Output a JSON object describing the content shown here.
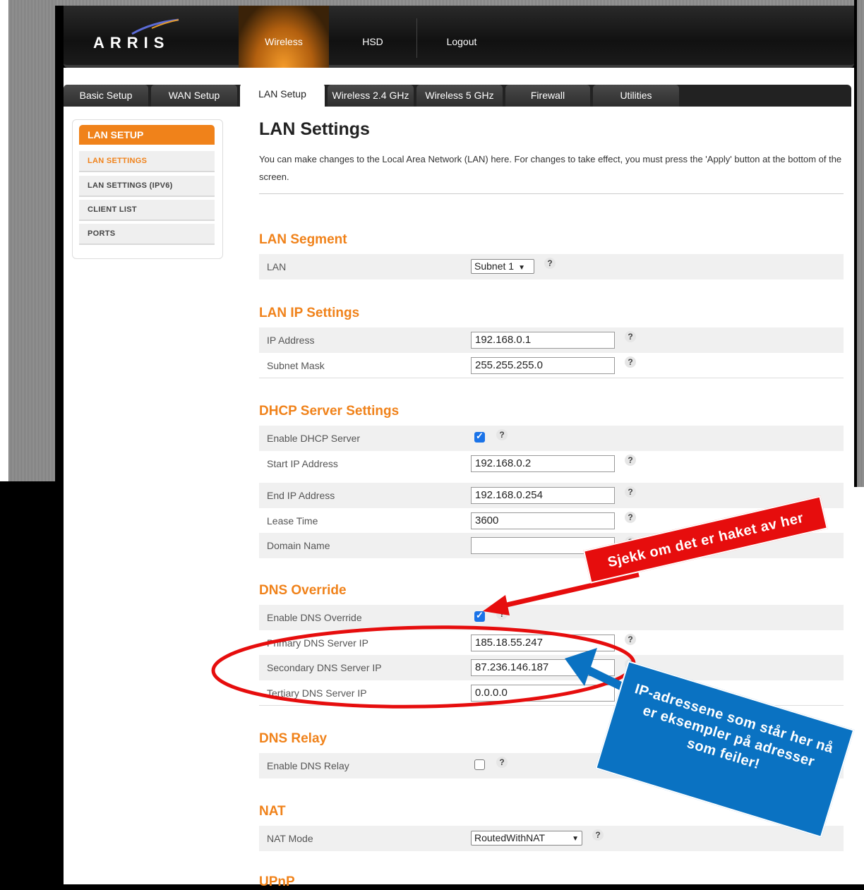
{
  "header": {
    "logo": "ARRIS",
    "nav": [
      "Wireless",
      "HSD",
      "Logout"
    ]
  },
  "tabs": [
    "Basic Setup",
    "WAN Setup",
    "LAN Setup",
    "Wireless 2.4 GHz",
    "Wireless 5 GHz",
    "Firewall",
    "Utilities"
  ],
  "sidebar": {
    "title": "LAN SETUP",
    "items": [
      "LAN SETTINGS",
      "LAN SETTINGS (IPV6)",
      "CLIENT LIST",
      "PORTS"
    ]
  },
  "main": {
    "title": "LAN Settings",
    "intro": "You can make changes to the Local Area Network (LAN) here. For changes to take effect, you must press the 'Apply' button at the bottom of the screen."
  },
  "help_glyph": "?",
  "lan_segment": {
    "heading": "LAN Segment",
    "lan_label": "LAN",
    "lan_value": "Subnet 1"
  },
  "lan_ip": {
    "heading": "LAN IP Settings",
    "ip_label": "IP Address",
    "ip_value": "192.168.0.1",
    "mask_label": "Subnet Mask",
    "mask_value": "255.255.255.0"
  },
  "dhcp": {
    "heading": "DHCP Server Settings",
    "enable_label": "Enable DHCP Server",
    "enabled": true,
    "start_label": "Start IP Address",
    "start_value": "192.168.0.2",
    "end_label": "End IP Address",
    "end_value": "192.168.0.254",
    "lease_label": "Lease Time",
    "lease_value": "3600",
    "domain_label": "Domain Name",
    "domain_value": ""
  },
  "dns_override": {
    "heading": "DNS Override",
    "enable_label": "Enable DNS Override",
    "enabled": true,
    "primary_label": "Primary DNS Server IP",
    "primary_value": "185.18.55.247",
    "secondary_label": "Secondary DNS Server IP",
    "secondary_value": "87.236.146.187",
    "tertiary_label": "Tertiary DNS Server IP",
    "tertiary_value": "0.0.0.0"
  },
  "dns_relay": {
    "heading": "DNS Relay",
    "enable_label": "Enable DNS Relay",
    "enabled": false
  },
  "nat": {
    "heading": "NAT",
    "mode_label": "NAT Mode",
    "mode_value": "RoutedWithNAT"
  },
  "upnp": {
    "heading": "UPnP"
  },
  "annotations": {
    "red_callout": "Sjekk om det er haket av her",
    "blue_callout_lines": [
      "IP-adressene som står her nå",
      "er eksempler på adresser",
      "som feiler!"
    ],
    "red_color": "#e60d0d",
    "blue_color": "#0a72c2"
  },
  "colors": {
    "accent": "#f0821a",
    "header_bg": "#111111"
  }
}
